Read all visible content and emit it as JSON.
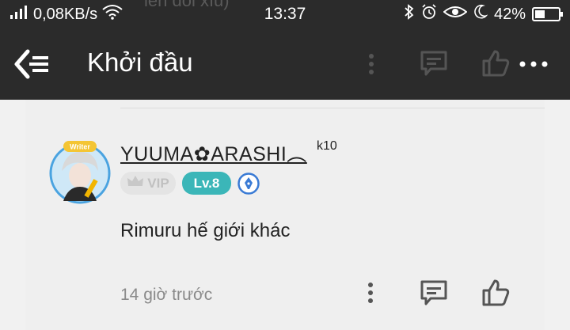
{
  "status_bar": {
    "speed": "0,08KB/s",
    "time": "13:37",
    "battery": "42%",
    "battery_level": 0.42,
    "background_text_fragment": "iên đôi xíu)"
  },
  "app_bar": {
    "title": "Khởi đầu",
    "icons": [
      "back-menu-icon",
      "more-vertical-icon",
      "comment-icon",
      "like-icon",
      "more-horizontal-icon"
    ]
  },
  "comment": {
    "username": "YUUMA✿ARASHI︵",
    "username_suffix": "k10",
    "avatar_badge": "Writer",
    "vip_label": "VIP",
    "level_label": "Lv.8",
    "text": "Rimuru hế giới khác",
    "time_ago": "14 giờ trước"
  },
  "colors": {
    "header_bg": "#2b2b2b",
    "content_bg": "#efefef",
    "level_badge": "#3bb6b8",
    "icon_gray": "#555555"
  }
}
